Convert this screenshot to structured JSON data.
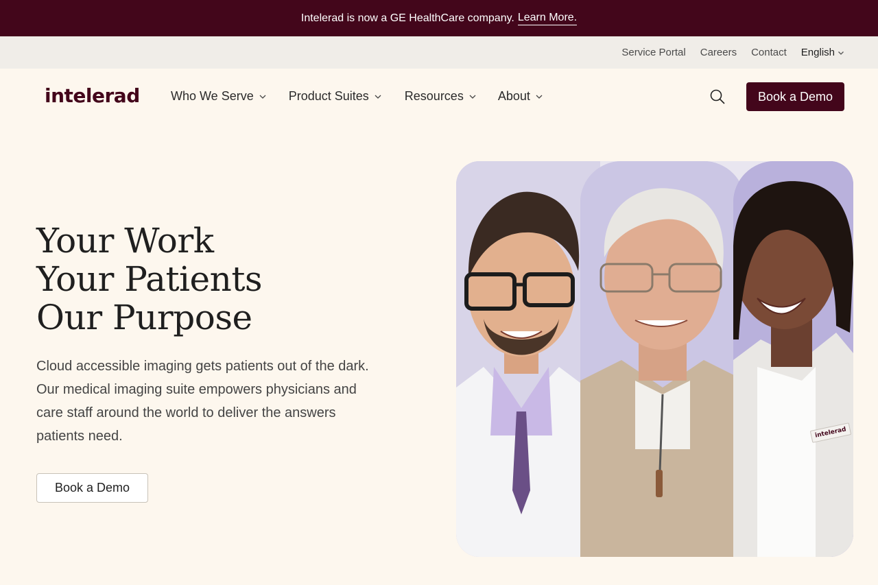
{
  "announcement": {
    "text": "Intelerad is now a GE HealthCare company.",
    "link_label": "Learn More."
  },
  "utility_nav": {
    "items": [
      "Service Portal",
      "Careers",
      "Contact"
    ],
    "language": "English"
  },
  "header": {
    "logo": "intelerad",
    "menu": [
      {
        "label": "Who We Serve"
      },
      {
        "label": "Product Suites"
      },
      {
        "label": "Resources"
      },
      {
        "label": "About"
      }
    ],
    "cta_label": "Book a Demo",
    "search_icon": "search-icon"
  },
  "hero": {
    "title_lines": [
      "Your Work",
      "Your Patients",
      "Our Purpose"
    ],
    "description": "Cloud accessible imaging gets patients out of the dark. Our medical imaging suite empowers physicians and care staff around the world to deliver the answers patients need.",
    "cta_label": "Book a Demo"
  },
  "collage": {
    "badge_text": "intelerad"
  },
  "colors": {
    "brand": "#43061b",
    "background": "#fdf7ee",
    "utility_bar": "#f0ede8",
    "collage_lavender": "#cbc6e4"
  }
}
